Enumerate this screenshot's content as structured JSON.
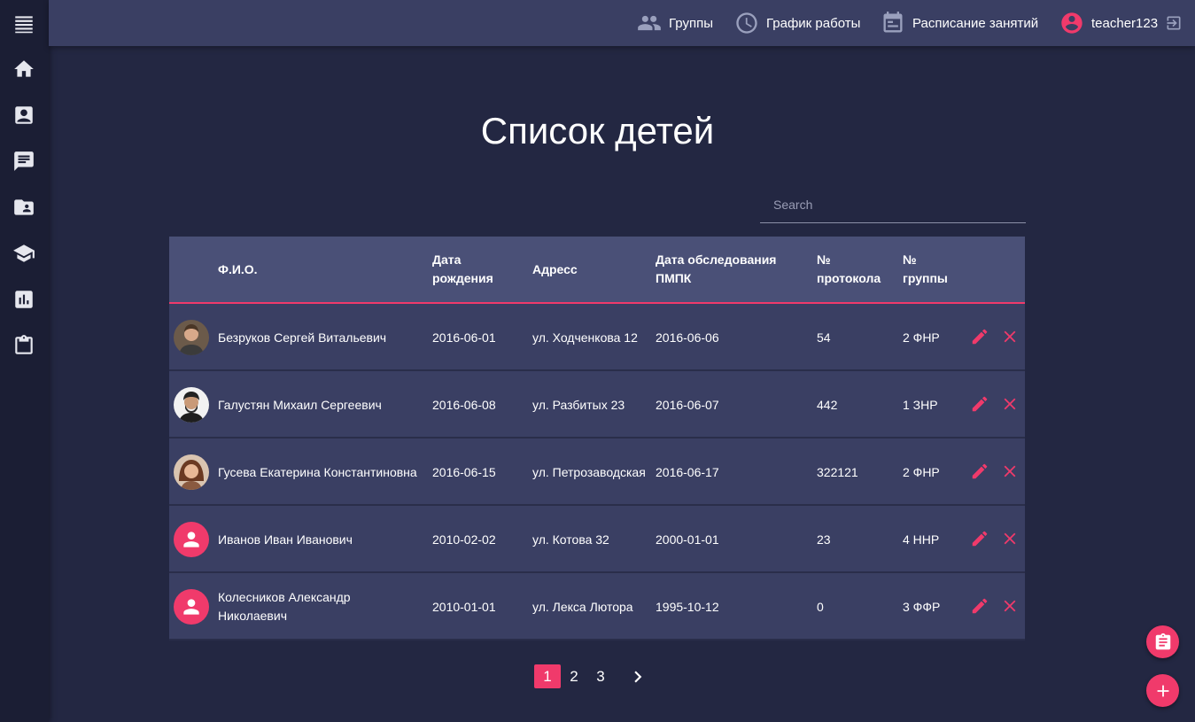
{
  "nav": {
    "groups": "Группы",
    "work_schedule": "График работы",
    "class_schedule": "Расписание занятий",
    "user": "teacher123"
  },
  "page_title": "Список детей",
  "search": {
    "placeholder": "Search"
  },
  "table": {
    "headers": {
      "fio": "Ф.И.О.",
      "dob": "Дата рождения",
      "address": "Адресс",
      "exam_date": "Дата обследования ПМПК",
      "protocol": "№ протокола",
      "group": "№ группы"
    },
    "rows": [
      {
        "fio": "Безруков Сергей Витальевич",
        "dob": "2016-06-01",
        "address": "ул. Ходченкова 12",
        "exam_date": "2016-06-06",
        "protocol": "54",
        "group": "2 ФНР",
        "avatar": "photo"
      },
      {
        "fio": "Галустян Михаил Сергеевич",
        "dob": "2016-06-08",
        "address": "ул. Разбитых 23",
        "exam_date": "2016-06-07",
        "protocol": "442",
        "group": "1 ЗНР",
        "avatar": "photo"
      },
      {
        "fio": "Гусева Екатерина Константиновна",
        "dob": "2016-06-15",
        "address": "ул. Петрозаводская",
        "exam_date": "2016-06-17",
        "protocol": "322121",
        "group": "2 ФНР",
        "avatar": "photo"
      },
      {
        "fio": "Иванов Иван Иванович",
        "dob": "2010-02-02",
        "address": "ул. Котова 32",
        "exam_date": "2000-01-01",
        "protocol": "23",
        "group": "4 ННР",
        "avatar": "default"
      },
      {
        "fio": "Колесников Александр Николаевич",
        "dob": "2010-01-01",
        "address": "ул. Лекса Лютора",
        "exam_date": "1995-10-12",
        "protocol": "0",
        "group": "3 ФФР",
        "avatar": "default"
      }
    ]
  },
  "pagination": {
    "pages": [
      "1",
      "2",
      "3"
    ],
    "current": "1"
  },
  "colors": {
    "accent": "#f03a6b",
    "background": "#232742",
    "topbar": "#3a3f63",
    "header_row": "#4a5077",
    "sidebar": "#1b1e34"
  },
  "icons": {
    "sidebar": [
      "menu-icon",
      "home-icon",
      "contact-card-icon",
      "chat-icon",
      "folder-user-icon",
      "graduation-cap-icon",
      "bar-chart-icon",
      "clipboard-icon"
    ],
    "row_actions": [
      "pencil-icon",
      "close-icon"
    ],
    "fabs": [
      "clipboard-icon",
      "plus-icon"
    ]
  }
}
